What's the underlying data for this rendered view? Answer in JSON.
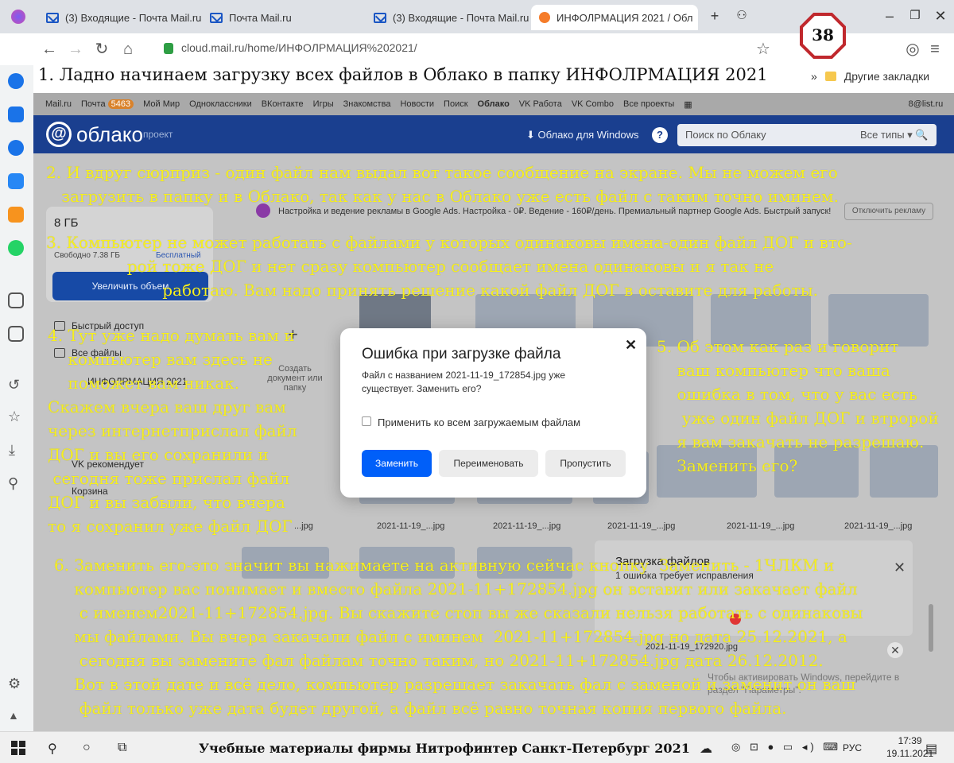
{
  "browser": {
    "tabs": [
      {
        "label": "(3) Входящие - Почта Mail.ru",
        "icon": "mail-icon"
      },
      {
        "label": "Почта Mail.ru",
        "icon": "mail-icon"
      },
      {
        "label": "(3) Входящие - Почта Mail.ru",
        "icon": "mail-icon"
      },
      {
        "label": "ИНФОЛРМАЦИЯ 2021 / Обл",
        "icon": "cloud-icon"
      }
    ],
    "url": "cloud.mail.ru/home/ИНФОЛРМАЦИЯ%202021/",
    "other_bookmarks": "Другие закладки",
    "badge_number": "38"
  },
  "mail_nav": {
    "items": [
      "Mail.ru",
      "Почта",
      "Мой Мир",
      "Одноклассники",
      "ВКонтакте",
      "Игры",
      "Знакомства",
      "Новости",
      "Поиск",
      "Облако",
      "VK Работа",
      "VK Combo",
      "Все проекты"
    ],
    "mail_count": "5463",
    "account": "8@list.ru"
  },
  "cloud": {
    "logo": "облако",
    "project": "проект",
    "windows_link": "Облако для Windows",
    "search_placeholder": "Поиск по Облаку",
    "search_type": "Все типы",
    "storage": "8 ГБ",
    "free": "Свободно 7.38 ГБ",
    "paid": "Бесплатный",
    "upgrade": "Увеличить объем",
    "nav": [
      "Быстрый доступ",
      "Все файлы",
      "ИНФОЛРМАЦИЯ 2021",
      "VK рекомендует",
      "Корзина"
    ],
    "ad_text": "Настройка и ведение рекламы в Google Ads. Настройка - 0₽. Ведение - 160₽/день. Премиальный партнер Google Ads. Быстрый запуск!",
    "ad_disable": "Отключить рекламу",
    "create_doc": "Создать документ или папку",
    "captions": [
      "...jpg",
      "2021-11-19_...jpg",
      "2021-11-19_...jpg",
      "2021-11-19_...jpg",
      "2021-11-19_...jpg",
      "2021-11-19_...jpg"
    ],
    "toast_title": "Загрузка файлов",
    "toast_sub": "1 ошибка требует исправления",
    "toast_file": "2021-11-19_172920.jpg",
    "windows_activation": "Чтобы активировать Windows, перейдите в раздел \"Параметры\"."
  },
  "dialog": {
    "title": "Ошибка при загрузке файла",
    "message": "Файл с названием 2021-11-19_172854.jpg уже существует. Заменить его?",
    "checkbox": "Применить ко всем загружаемым файлам",
    "replace": "Заменить",
    "rename": "Переименовать",
    "skip": "Пропустить"
  },
  "annotations": {
    "step1": "1. Ладно начинаем загрузку всех файлов в Облако в папку ИНФОЛРМАЦИЯ 2021",
    "step2": "2. И вдруг сюрприз - один файл нам выдал вот такое сообщение на экране. Мы не можем его\n   загрузить в папку и в Облако, так как у нас в Облако уже есть файл с таким точно иминем.",
    "step3": "3. Компьютер не может работать с файлами у которых одинаковы имена-один файл ДОГ и вто-\n                рой тоже ДОГ и нет сразу компьютер сообщает имена одинаковы и я так не\n                       работаю. Вам надо принять решение какой файл ДОГ в оставите для работы.",
    "step4": "4. Тут уже надо думать вам и\n    компьютер вам здесь не\n    поможет вам никак.\nСкажем вчера ваш друг вам\nчерез интернетприслал файл\nДОГ и вы его сохранили и\n сегодня тоже прислал файл\nДОГ и вы забыли, что вчера\nто я сохранил уже файл ДОГ",
    "step5": "5. Об этом как раз и говорит\n    ваш компьютер что ваша\n    ошибка в том, что у вас есть\n     уже один файл ДОГ и втророй\n    я вам закачать не разрешаю.\n    Заменить его?",
    "step6": "6. Заменить его-это значит вы нажимаете на активную сейчас кнопку  Заменить - 1ЧЛКМ и\n    компьютер вас понимает и вместо файла 2021-11+172854.jpg он вставит или закачает файл\n     с именем2021-11+172854.jpg. Вы скажите стоп вы же сказали нельзя работать с одинаковы\n    мы файлами. Вы вчера закачали файл с иминем  2021-11+172854.jpg но дата 25.12.2021, а\n     сегодня вы замените фал файлам точно таким, но 2021-11+172854.jpg дата 26.12.2012.\n    Вот в этой дате и всё дело, компьютер разрешает закачать фал с заменой и заменит он ваш\n     файл только уже дата будет другой, а файл всё равно точная копия первого файла."
  },
  "taskbar": {
    "title": "Учебные материалы фирмы Нитрофинтер  Санкт-Петербург  2021",
    "lang": "РУС",
    "time": "17:39",
    "date": "19.11.2021"
  }
}
